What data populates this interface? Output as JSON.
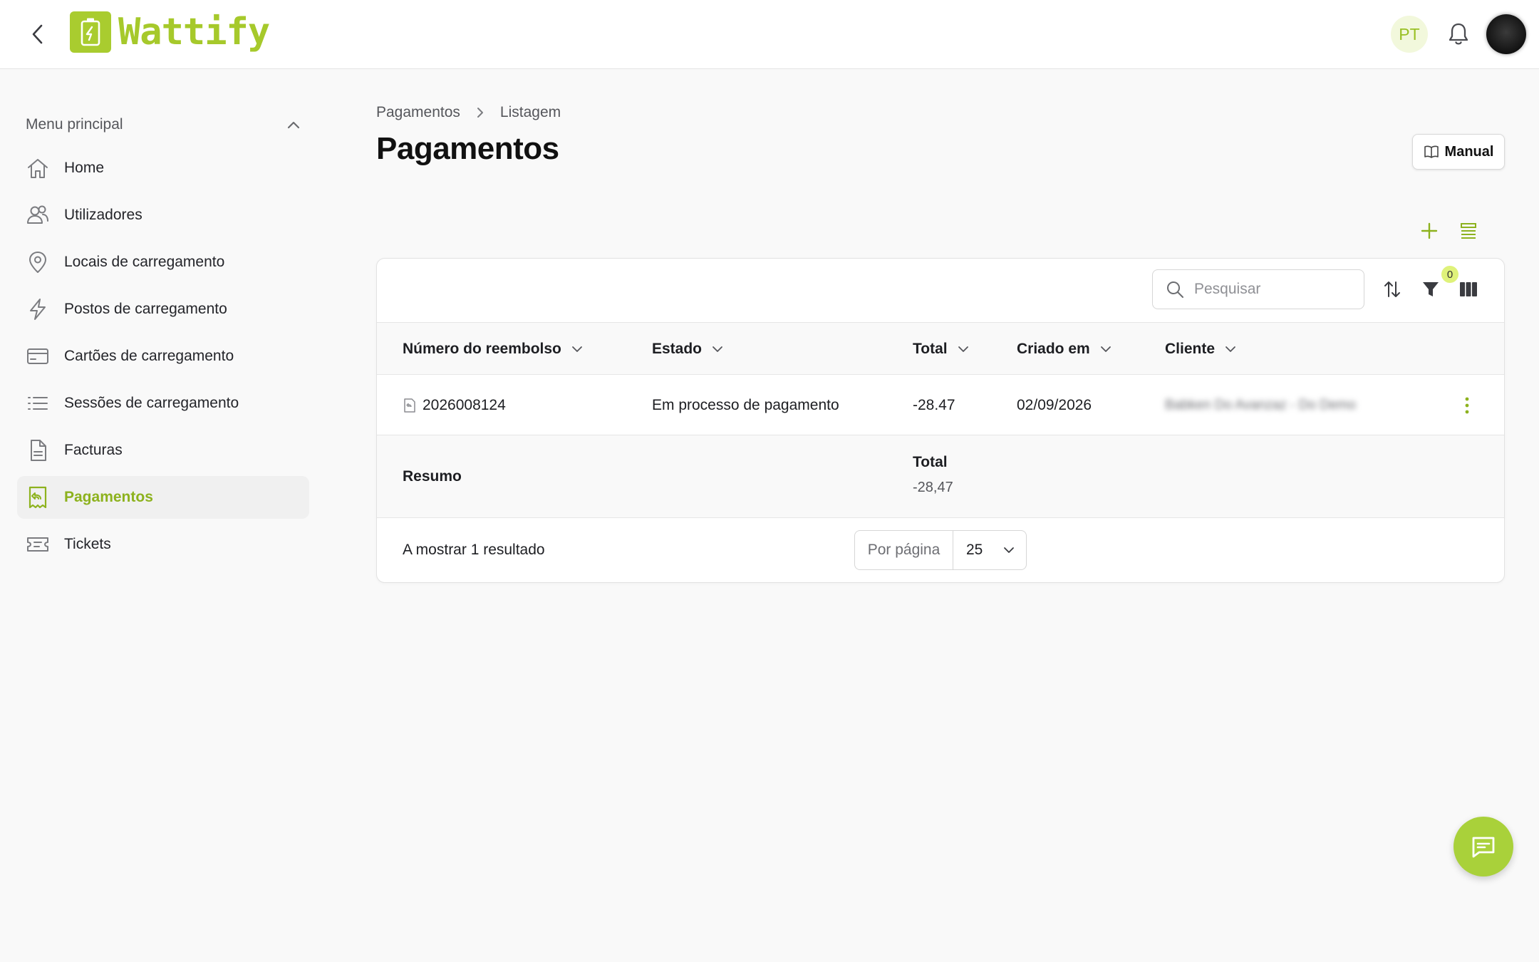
{
  "app": {
    "name": "Wattify",
    "language": "PT",
    "accent_color": "#a6c92b"
  },
  "header": {
    "back_icon": "chevron-left-icon",
    "notifications_icon": "bell-icon"
  },
  "sidebar": {
    "heading": "Menu principal",
    "items": [
      {
        "label": "Home",
        "icon": "home-icon"
      },
      {
        "label": "Utilizadores",
        "icon": "users-icon"
      },
      {
        "label": "Locais de carregamento",
        "icon": "map-pin-icon"
      },
      {
        "label": "Postos de carregamento",
        "icon": "lightning-icon"
      },
      {
        "label": "Cartões de carregamento",
        "icon": "credit-card-icon"
      },
      {
        "label": "Sessões de carregamento",
        "icon": "list-icon"
      },
      {
        "label": "Facturas",
        "icon": "file-icon"
      },
      {
        "label": "Pagamentos",
        "icon": "receipt-refund-icon",
        "active": true
      },
      {
        "label": "Tickets",
        "icon": "ticket-icon"
      }
    ]
  },
  "breadcrumb": [
    "Pagamentos",
    "Listagem"
  ],
  "page": {
    "title": "Pagamentos",
    "manual_label": "Manual"
  },
  "table": {
    "search_placeholder": "Pesquisar",
    "filter_count": "0",
    "columns": [
      "Número do reembolso",
      "Estado",
      "Total",
      "Criado em",
      "Cliente"
    ],
    "rows": [
      {
        "number": "2026008124",
        "status": "Em processo de pagamento",
        "total": "-28.47",
        "created": "02/09/2026",
        "client": "Babken Do Avanzaz - Do Demo"
      }
    ],
    "summary": {
      "label": "Resumo",
      "total_label": "Total",
      "total_value": "-28,47"
    },
    "footer": {
      "results": "A mostrar 1 resultado",
      "per_page_label": "Por página",
      "per_page_value": "25"
    }
  }
}
